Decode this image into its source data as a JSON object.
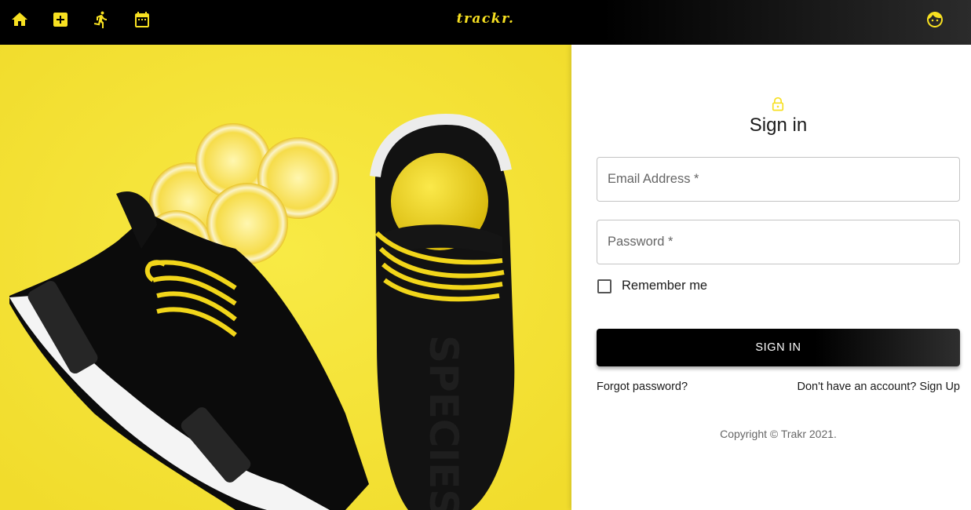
{
  "appbar": {
    "brand": "trackr.",
    "nav_icons": [
      "home-icon",
      "add-box-icon",
      "running-icon",
      "calendar-icon"
    ],
    "account_icon": "face-icon",
    "accent_color": "#f7e021"
  },
  "hero": {
    "image": "black sneakers with yellow laces and lemon slices on yellow background",
    "shoe_text": "SPECIES"
  },
  "signin": {
    "title": "Sign in",
    "email_label": "Email Address *",
    "password_label": "Password *",
    "remember_label": "Remember me",
    "remember_checked": false,
    "button_label": "SIGN IN",
    "forgot_link": "Forgot password?",
    "signup_link": "Don't have an account? Sign Up",
    "copyright": "Copyright © Trakr 2021."
  }
}
